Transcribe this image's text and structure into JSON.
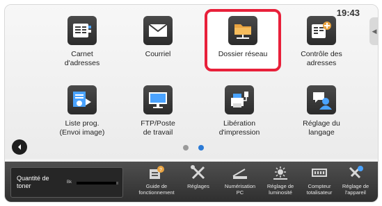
{
  "status": {
    "time": "19:43"
  },
  "apps": [
    {
      "label": "Carnet\nd'adresses",
      "icon": "address-book-icon"
    },
    {
      "label": "Courriel",
      "icon": "mail-icon"
    },
    {
      "label": "Dossier réseau",
      "icon": "network-folder-icon",
      "selected": true
    },
    {
      "label": "Contrôle des\nadresses",
      "icon": "address-check-icon"
    },
    {
      "label": "Liste prog.\n(Envoi image)",
      "icon": "program-list-icon"
    },
    {
      "label": "FTP/Poste\nde travail",
      "icon": "ftp-desktop-icon"
    },
    {
      "label": "Libération\nd'impression",
      "icon": "print-release-icon"
    },
    {
      "label": "Réglage du\nlangage",
      "icon": "language-icon"
    }
  ],
  "pager": {
    "pages": 2,
    "active_page": 2
  },
  "toner": {
    "label": "Quantité de\ntoner",
    "color_label": "Bk",
    "level": 0.95
  },
  "dock": [
    {
      "label": "Guide de\nfonctionnement",
      "icon": "guide-icon"
    },
    {
      "label": "Réglages",
      "icon": "settings-tools-icon"
    },
    {
      "label": "Numérisation\nPC",
      "icon": "pc-scan-icon"
    },
    {
      "label": "Réglage de\nluminosité",
      "icon": "brightness-icon"
    },
    {
      "label": "Compteur\ntotalisateur",
      "icon": "counter-icon"
    },
    {
      "label": "Réglage de\nl'appareil",
      "icon": "device-settings-icon"
    }
  ],
  "colors": {
    "selection": "#e8203a",
    "active_dot": "#2b7ad6",
    "folder": "#e8a341",
    "dock_bg": "#3a3a3a"
  }
}
